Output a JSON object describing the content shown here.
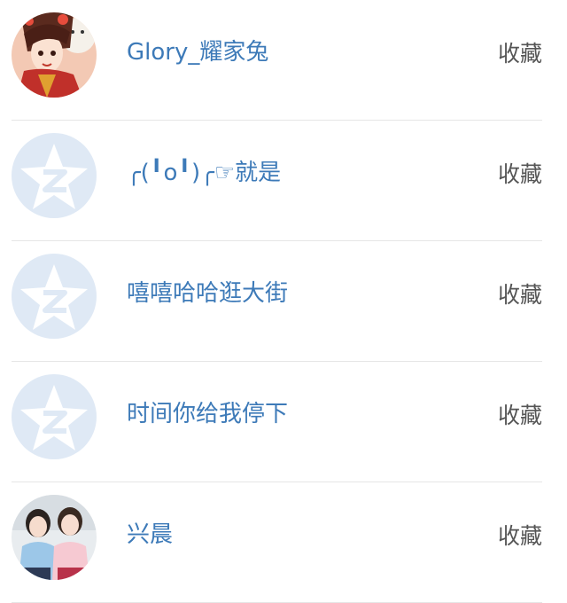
{
  "friends": [
    {
      "name": "Glory_耀家兔",
      "action": "收藏",
      "avatar": "photo-avatar-cartoon-girl"
    },
    {
      "name": "╭(╹o╹)╭☞就是",
      "action": "收藏",
      "avatar": "default-qzone-star-avatar"
    },
    {
      "name": "嘻嘻哈哈逛大街",
      "action": "收藏",
      "avatar": "default-qzone-star-avatar"
    },
    {
      "name": "时间你给我停下",
      "action": "收藏",
      "avatar": "default-qzone-star-avatar"
    },
    {
      "name": "兴晨",
      "action": "收藏",
      "avatar": "photo-avatar-two-girls"
    }
  ],
  "colors": {
    "name": "#3d7ab8",
    "action": "#555555",
    "divider": "#e6e6e6",
    "default_avatar_bg": "#dfe9f5"
  }
}
